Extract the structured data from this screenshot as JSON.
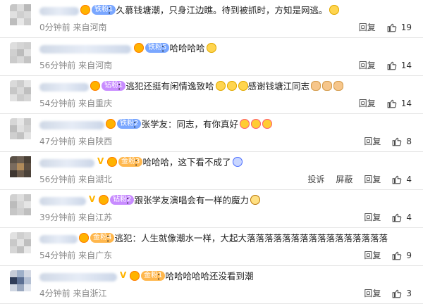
{
  "comments": [
    {
      "badge": "铁粉1",
      "badge_type": "iron",
      "text": "：久慕钱塘潮，只身江边瞧。待到被抓时，方知是网逃。",
      "emojis": [
        "grin-emoji"
      ],
      "meta": "0分钟前  来自河南",
      "actions": [
        "回复"
      ],
      "likes": "19"
    },
    {
      "badge": "铁粉5",
      "badge_type": "iron",
      "text": "：哈哈哈哈",
      "emojis": [
        "laugh-cry-emoji"
      ],
      "meta": "56分钟前  来自河南",
      "actions": [
        "回复"
      ],
      "likes": "14"
    },
    {
      "badge": "钻粉1",
      "badge_type": "drill",
      "text": "：逃犯还挺有闲情逸致哈",
      "text2": "感谢钱塘江同志",
      "emojis": [
        "laugh-cry-emoji",
        "laugh-cry-emoji",
        "laugh-cry-emoji"
      ],
      "emojis2": [
        "pray-emoji",
        "pray-emoji",
        "pray-emoji"
      ],
      "meta": "54分钟前  来自重庆",
      "actions": [
        "回复"
      ],
      "likes": "14"
    },
    {
      "badge": "铁粉2",
      "badge_type": "iron",
      "text": "：张学友：同志，有你真好",
      "emojis": [
        "heart-eyes-emoji",
        "heart-eyes-emoji",
        "heart-eyes-emoji"
      ],
      "meta": "47分钟前  来自陕西",
      "actions": [
        "回复"
      ],
      "likes": "8"
    },
    {
      "badge": "金粉3",
      "badge_type": "gold",
      "vip": "V",
      "text": "：哈哈哈，这下看不成了",
      "emojis": [
        "ghost-emoji"
      ],
      "meta": "56分钟前  来自湖北",
      "actions": [
        "投诉",
        "屏蔽",
        "回复"
      ],
      "likes": "4"
    },
    {
      "badge": "钻粉2",
      "badge_type": "drill",
      "vip": "V",
      "text": "：跟张学友演唱会有一样的魔力",
      "emojis": [
        "bear-emoji"
      ],
      "meta": "39分钟前  来自江苏",
      "actions": [
        "回复"
      ],
      "likes": "4"
    },
    {
      "badge": "金粉4",
      "badge_type": "gold",
      "text": "：逃犯：人生就像潮水一样，大起大落落落落落落落落落落落落落落落落",
      "emojis": [],
      "meta": "54分钟前  来自广东",
      "actions": [
        "回复"
      ],
      "likes": "9"
    },
    {
      "badge": "金粉1",
      "badge_type": "gold",
      "vip": "V",
      "text": "：哈哈哈哈哈还没看到潮",
      "emojis": [],
      "meta": "4分钟前  来自浙江",
      "actions": [
        "回复"
      ],
      "likes": "3"
    }
  ]
}
